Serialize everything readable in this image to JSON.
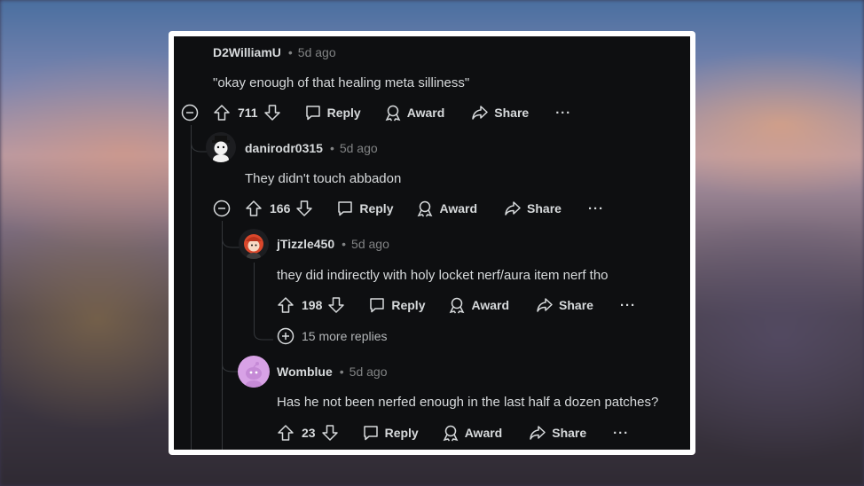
{
  "comments": [
    {
      "author": "D2WilliamU",
      "time": "5d ago",
      "text": "\"okay enough of that healing meta silliness\"",
      "score": "711",
      "reply": "Reply",
      "award": "Award",
      "share": "Share",
      "more": "···"
    },
    {
      "author": "danirodr0315",
      "time": "5d ago",
      "text": "They didn't touch abbadon",
      "score": "166",
      "reply": "Reply",
      "award": "Award",
      "share": "Share",
      "more": "···"
    },
    {
      "author": "jTizzle450",
      "time": "5d ago",
      "text": "they did indirectly with holy locket nerf/aura item nerf tho",
      "score": "198",
      "reply": "Reply",
      "award": "Award",
      "share": "Share",
      "more": "···"
    },
    {
      "author": "Womblue",
      "time": "5d ago",
      "text": "Has he not been nerfed enough in the last half a dozen patches?",
      "score": "23",
      "reply": "Reply",
      "award": "Award",
      "share": "Share",
      "more": "···"
    }
  ],
  "more_replies": "15 more replies",
  "separator": "•",
  "colors": {
    "background": "#0e0f11",
    "text": "#d7dadc",
    "muted": "#818384",
    "frame": "#ffffff"
  },
  "icons": [
    "upvote-icon",
    "downvote-icon",
    "reply-icon",
    "award-icon",
    "share-icon",
    "collapse-icon",
    "expand-icon"
  ]
}
